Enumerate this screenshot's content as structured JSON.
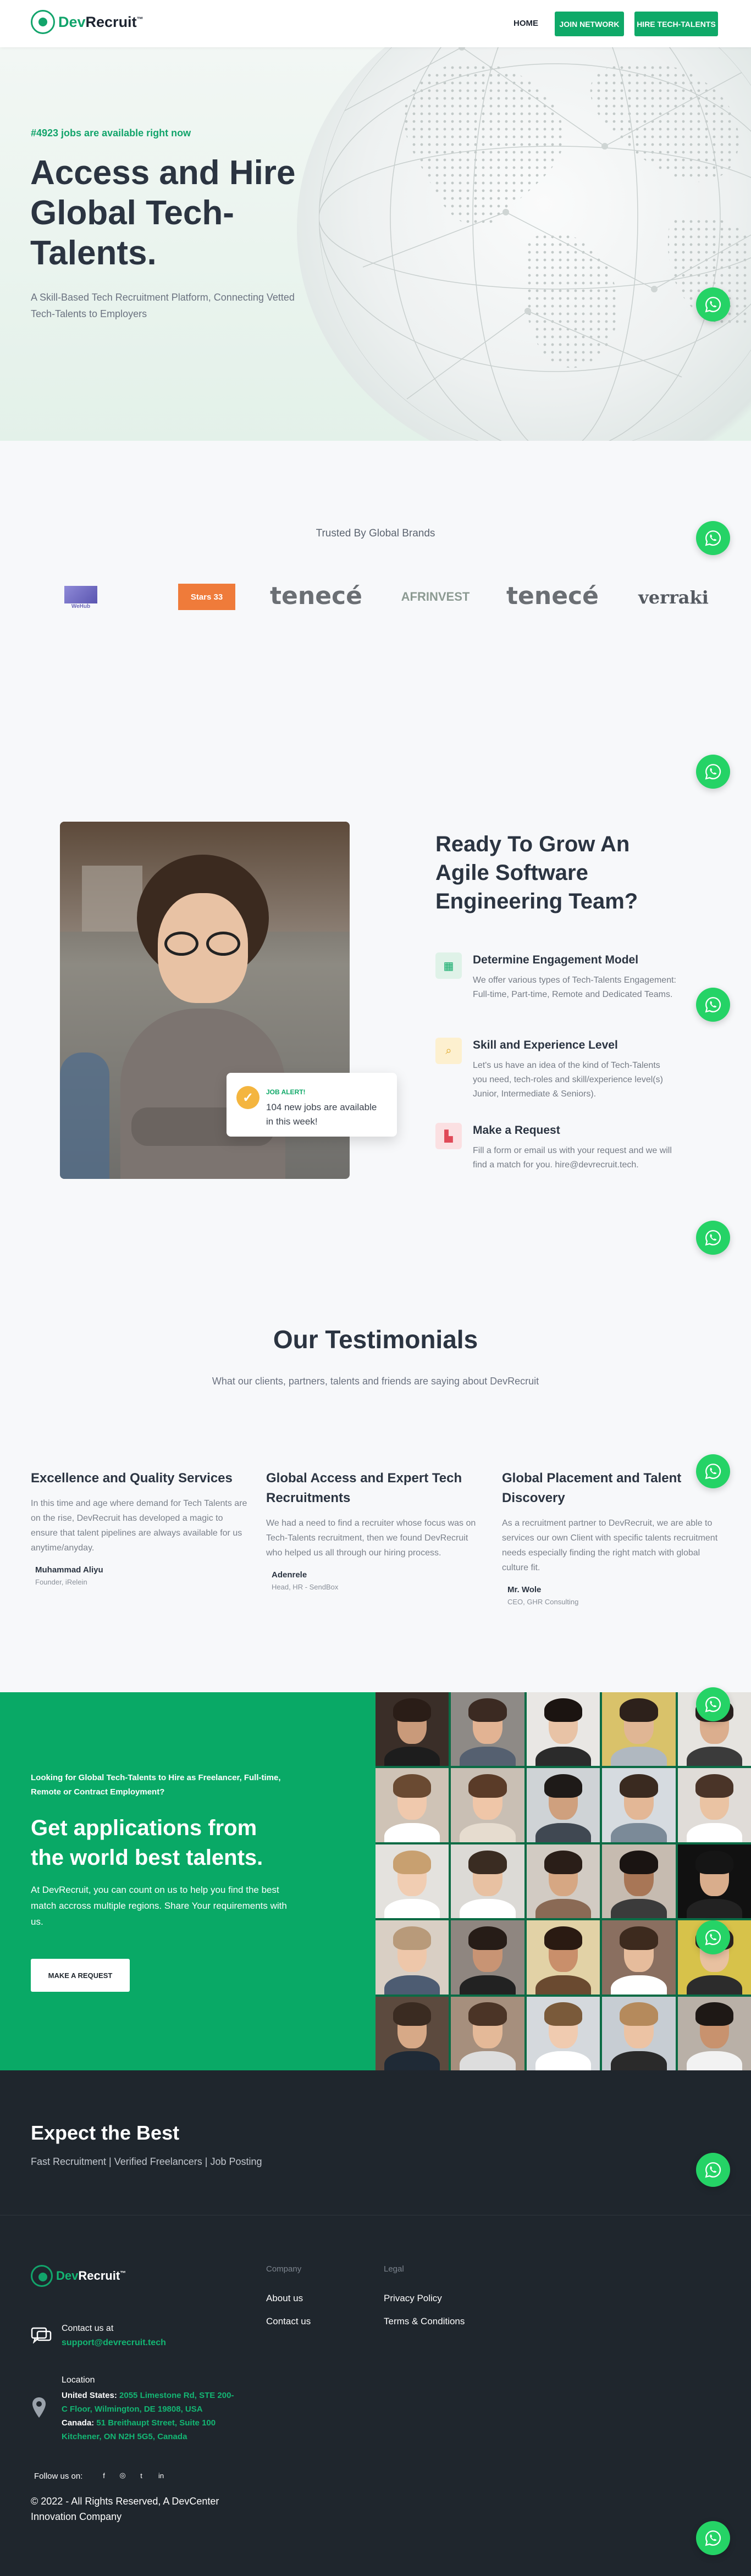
{
  "header": {
    "logo_text_a": "Dev",
    "logo_text_b": "Recruit",
    "trademark": "™",
    "nav_home": "HOME",
    "join_button": "JOIN NETWORK",
    "hire_button": "HIRE TECH-TALENTS"
  },
  "hero": {
    "jobs_available": "#4923 jobs are available right now",
    "title": "Access and Hire Global Tech-Talents.",
    "subtitle": "A Skill-Based Tech Recruitment Platform, Connecting Vetted Tech-Talents to Employers"
  },
  "brands": {
    "title": "Trusted By Global Brands",
    "items": [
      "WeHub",
      "Stars 33",
      "tenecé",
      "AFRINVEST",
      "tenecé",
      "verraki"
    ]
  },
  "engagement": {
    "alert_label": "JOB ALERT!",
    "alert_text": "104 new jobs are available in this week!",
    "title": "Ready To Grow An Agile Software Engineering Team?",
    "features": [
      {
        "title": "Determine Engagement Model",
        "text": "We offer various types of Tech-Talents Engagement: Full-time, Part-time, Remote and Dedicated Teams."
      },
      {
        "title": "Skill and Experience Level",
        "text": "Let's us have an idea of the kind of Tech-Talents you need, tech-roles and skill/experience level(s) Junior, Intermediate & Seniors)."
      },
      {
        "title": "Make a Request",
        "text": "Fill a form or email us with your request and we will find a match for you. hire@devrecruit.tech."
      }
    ]
  },
  "testimonials": {
    "title": "Our Testimonials",
    "subtitle": "What our clients, partners, talents and friends are saying about DevRecruit",
    "items": [
      {
        "title": "Excellence and Quality Services",
        "text": "In this time and age where demand for Tech Talents are on the rise, DevRecruit has developed a magic to ensure that talent pipelines are always available for us anytime/anyday.",
        "name": "Muhammad Aliyu",
        "role": "Founder, iRelein"
      },
      {
        "title": "Global Access and Expert Tech Recruitments",
        "text": "We had a need to find a recruiter whose focus was on Tech-Talents recruitment, then we found DevRecruit who helped us all through our hiring process.",
        "name": "Adenrele",
        "role": "Head, HR - SendBox"
      },
      {
        "title": "Global Placement and Talent Discovery",
        "text": "As a recruitment partner to DevRecruit, we are able to services our own Client with specific talents recruitment needs especially finding the right match with global culture fit.",
        "name": "Mr. Wole",
        "role": "CEO, GHR Consulting"
      }
    ]
  },
  "cta": {
    "kicker": "Looking for Global Tech-Talents to Hire as Freelancer, Full-time, Remote or Contract Employment?",
    "title": "Get applications from the world best talents.",
    "text": "At DevRecruit, you can count on us to help you find the best match accross multiple regions. Share Your requirements with us.",
    "button": "MAKE A REQUEST"
  },
  "footer": {
    "expect_title": "Expect the Best",
    "expect_tags": "Fast Recruitment | Verified Freelancers | Job Posting",
    "company_head": "Company",
    "legal_head": "Legal",
    "about": "About us",
    "contact": "Contact us",
    "privacy": "Privacy Policy",
    "terms": "Terms & Conditions",
    "contact_label": "Contact us at",
    "contact_email": "support@devrecruit.tech",
    "location_label": "Location",
    "us_label": "United States:",
    "us_address": "2055 Limestone Rd, STE 200-C Floor, Wilmington, DE 19808, USA",
    "ca_label": "Canada:",
    "ca_address": "51 Breithaupt Street, Suite 100 Kitchener, ON N2H 5G5, Canada",
    "follow": "Follow us on:",
    "social": [
      "f",
      "◎",
      "t",
      "in"
    ],
    "copyright": "© 2022 - All Rights Reserved, A DevCenter Innovation Company"
  },
  "colors": {
    "brand_green": "#0fa968",
    "dark": "#1f262d",
    "whatsapp": "#25d366"
  }
}
